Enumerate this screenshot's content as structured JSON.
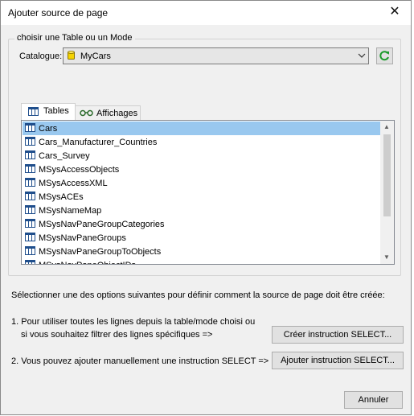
{
  "window": {
    "title": "Ajouter source de page"
  },
  "group": {
    "label": "choisir une Table ou un Mode"
  },
  "catalogue": {
    "label": "Catalogue:",
    "value": "MyCars"
  },
  "tabs": {
    "tables": "Tables",
    "views": "Affichages"
  },
  "list": {
    "items": [
      "Cars",
      "Cars_Manufacturer_Countries",
      "Cars_Survey",
      "MSysAccessObjects",
      "MSysAccessXML",
      "MSysACEs",
      "MSysNameMap",
      "MSysNavPaneGroupCategories",
      "MSysNavPaneGroups",
      "MSysNavPaneGroupToObjects",
      "MSysNavPaneObjectIDs"
    ],
    "selected": "Cars"
  },
  "instructions": {
    "description": "Sélectionner une des options suivantes pour définir comment la source de page doit être créée:",
    "option1_line1": "1. Pour utiliser toutes les lignes depuis la table/mode choisi ou",
    "option1_line2": "si vous souhaitez filtrer des lignes spécifiques =>",
    "option2": "2. Vous pouvez ajouter manuellement une instruction SELECT =>"
  },
  "buttons": {
    "create_select": "Créer instruction SELECT...",
    "add_select": "Ajouter instruction SELECT...",
    "cancel": "Annuler"
  },
  "icons": {
    "close": "close-icon",
    "database": "database-icon",
    "refresh": "refresh-icon",
    "table": "table-icon",
    "views": "glasses-icon"
  },
  "colors": {
    "selection": "#99c8ef",
    "database_icon": "#f5d300",
    "refresh_icon": "#1a9a2a",
    "table_icon": "#1f4e8c"
  }
}
